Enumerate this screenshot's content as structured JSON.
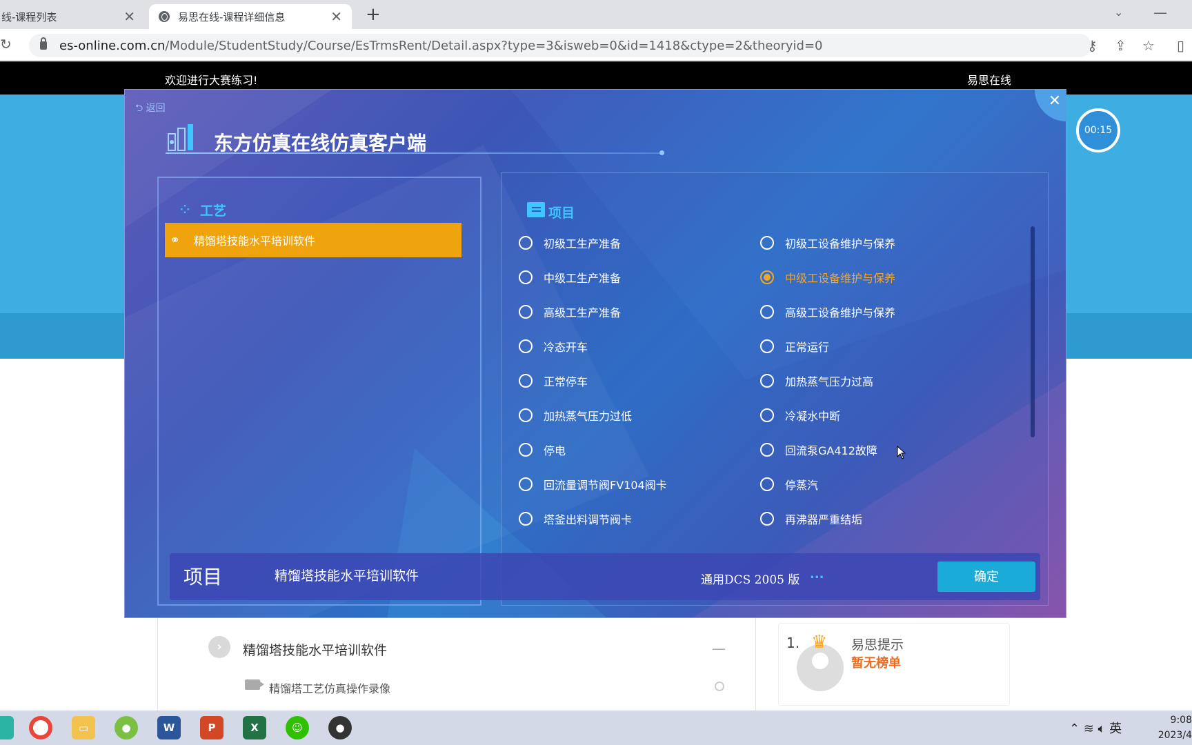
{
  "browser": {
    "tabs": [
      {
        "title": "线-课程列表"
      },
      {
        "title": "易思在线-课程详细信息"
      }
    ],
    "tab_close": "✕",
    "new_tab": "+",
    "url_host": "es-online.com.cn",
    "url_path": "/Module/StudentStudy/Course/EsTrmsRent/Detail.aspx?type=3&isweb=0&id=1418&ctype=2&theoryid=0"
  },
  "site": {
    "welcome": "欢迎进行大赛练习!",
    "name": "易思在线"
  },
  "modal": {
    "return_label": "返回",
    "close_label": "✕",
    "title": "东方仿真在线仿真客户端",
    "craft_section": {
      "heading": "工艺",
      "items": [
        {
          "label": "精馏塔技能水平培训软件",
          "selected": true
        }
      ]
    },
    "project_section": {
      "heading": "项目",
      "left_options": [
        "初级工生产准备",
        "中级工生产准备",
        "高级工生产准备",
        "冷态开车",
        "正常停车",
        "加热蒸气压力过低",
        "停电",
        "回流量调节阀FV104阀卡",
        "塔釜出料调节阀卡"
      ],
      "right_options": [
        "初级工设备维护与保养",
        "中级工设备维护与保养",
        "高级工设备维护与保养",
        "正常运行",
        "加热蒸气压力过高",
        "冷凝水中断",
        "回流泵GA412故障",
        "停蒸汽",
        "再沸器严重结垢"
      ],
      "selected_option": "中级工设备维护与保养"
    },
    "footer": {
      "label": "项目",
      "value": "精馏塔技能水平培训软件",
      "version": "通用DCS 2005 版",
      "more": "...",
      "confirm": "确定"
    }
  },
  "timer": "00:15",
  "course": {
    "title": "精馏塔技能水平培训软件",
    "collapse": "—",
    "video": "精馏塔工艺仿真操作录像"
  },
  "ranking": {
    "rank": "1.",
    "tip": "易思提示",
    "empty": "暂无榜单"
  },
  "taskbar": {
    "ime": "英",
    "time": "9:08",
    "date": "2023/4"
  },
  "colors": {
    "accent_orange": "#efa30c",
    "cyan": "#3fc5ff",
    "confirm": "#1aabd9"
  }
}
